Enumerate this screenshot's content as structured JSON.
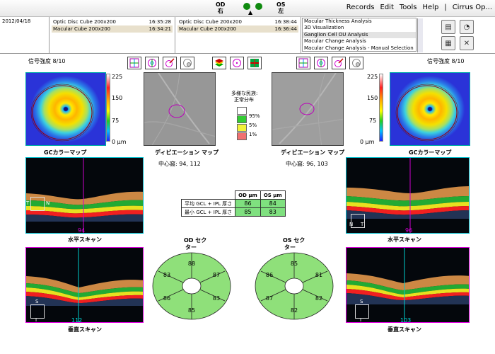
{
  "topbar": {
    "od_label": "OD",
    "od_sub": "右",
    "os_label": "OS",
    "os_sub": "左",
    "arrow": "▲",
    "menu": [
      "Records",
      "Edit",
      "Tools",
      "Help",
      "|",
      "Cirrus Op..."
    ]
  },
  "exams": {
    "date": "2012/04/18",
    "od_scans": [
      {
        "name": "Optic Disc Cube 200x200",
        "time": "16:35:28",
        "selected": false
      },
      {
        "name": "Macular Cube 200x200",
        "time": "16:34:21",
        "selected": true
      }
    ],
    "os_scans": [
      {
        "name": "Optic Disc Cube 200x200",
        "time": "16:38:44",
        "selected": false
      },
      {
        "name": "Macular Cube 200x200",
        "time": "16:36:44",
        "selected": true
      }
    ],
    "analyses": [
      {
        "name": "Macular Thickness Analysis",
        "selected": false
      },
      {
        "name": "3D Visualization",
        "selected": false
      },
      {
        "name": "Ganglion Cell OU Analysis",
        "selected": true
      },
      {
        "name": "Macular Change Analysis",
        "selected": false
      },
      {
        "name": "Macular Change Analysis - Manual Selection",
        "selected": false
      }
    ]
  },
  "signal": {
    "od": "信号強度  8/10",
    "os": "信号強度  8/10"
  },
  "colorbar": {
    "t225": "225",
    "t150": "150",
    "t75": "75",
    "t0": "0 µm"
  },
  "labels": {
    "gc_map_od": "GCカラーマップ",
    "gc_map_os": "GCカラーマップ",
    "dev_map_od": "ディビエーション マップ",
    "dev_map_os": "ディビエーション マップ",
    "fovea_od": "中心窩: 94, 112",
    "fovea_os": "中心窩: 96, 103",
    "hscan_od": "水平スキャン",
    "hscan_os": "水平スキャン",
    "vscan_od": "垂直スキャン",
    "vscan_os": "垂直スキャン",
    "hscan_num_od": "94",
    "hscan_num_os": "96",
    "vscan_num_od": "112",
    "vscan_num_os": "103",
    "T": "T",
    "N": "N",
    "S": "S",
    "I": "I"
  },
  "legend": {
    "title1": "多様な民族:",
    "title2": "正常分布",
    "p95": "95%",
    "p5": "5%",
    "p1": "1%",
    "colors": [
      "#ffffff",
      "#33cc33",
      "#f2f23a",
      "#f07070"
    ]
  },
  "thickness": {
    "col_od": "OD µm",
    "col_os": "OS µm",
    "rows": [
      {
        "label": "平均 GCL + IPL 厚さ",
        "od": "86",
        "os": "84"
      },
      {
        "label": "最小 GCL + IPL 厚さ",
        "od": "85",
        "os": "83"
      }
    ]
  },
  "sectors": {
    "od_title1": "OD セク",
    "od_title2": "ター",
    "os_title1": "OS セク",
    "os_title2": "ター",
    "od": {
      "top": "88",
      "upper_left": "83",
      "upper_right": "87",
      "lower_left": "86",
      "lower_right": "83",
      "bottom": "85"
    },
    "os": {
      "top": "85",
      "upper_left": "86",
      "upper_right": "81",
      "lower_left": "87",
      "lower_right": "82",
      "bottom": "82"
    },
    "fill": "#8fe07a"
  }
}
